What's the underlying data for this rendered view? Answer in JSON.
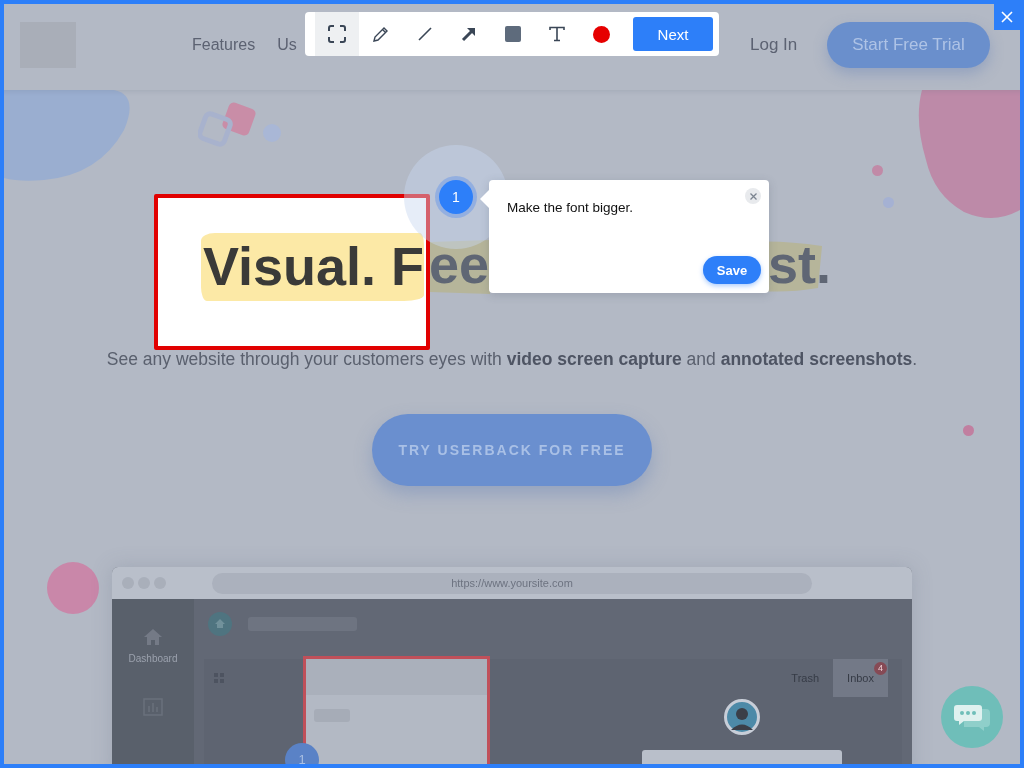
{
  "header": {
    "nav": [
      {
        "label": "Features"
      },
      {
        "label": "Us"
      }
    ],
    "login": "Log In",
    "cta": "Start Free Trial"
  },
  "toolbar": {
    "tools": [
      {
        "kind": "select",
        "selected": true
      },
      {
        "kind": "pen",
        "selected": false
      },
      {
        "kind": "line",
        "selected": false
      },
      {
        "kind": "arrow",
        "selected": false
      },
      {
        "kind": "rectangle",
        "selected": false
      },
      {
        "kind": "text",
        "selected": false
      },
      {
        "kind": "color",
        "selected": false,
        "color": "#e60000"
      }
    ],
    "next": "Next"
  },
  "annotation": {
    "box_text": "Visual. F",
    "marker": "1",
    "comment": "Make the font bigger.",
    "save": "Save"
  },
  "hero": {
    "headline_parts": [
      "ee",
      "st."
    ],
    "subtitle": "See any website through your customers eyes with **video screen capture** and **annotated screenshots**.",
    "cta": "TRY USERBACK FOR FREE"
  },
  "mockup": {
    "url": "https://www.yoursite.com",
    "sidebar": [
      "Dashboard"
    ],
    "tabs": [
      {
        "label": "Trash",
        "selected": false
      },
      {
        "label": "Inbox",
        "selected": true,
        "badge": "4"
      }
    ],
    "marker": "1"
  }
}
